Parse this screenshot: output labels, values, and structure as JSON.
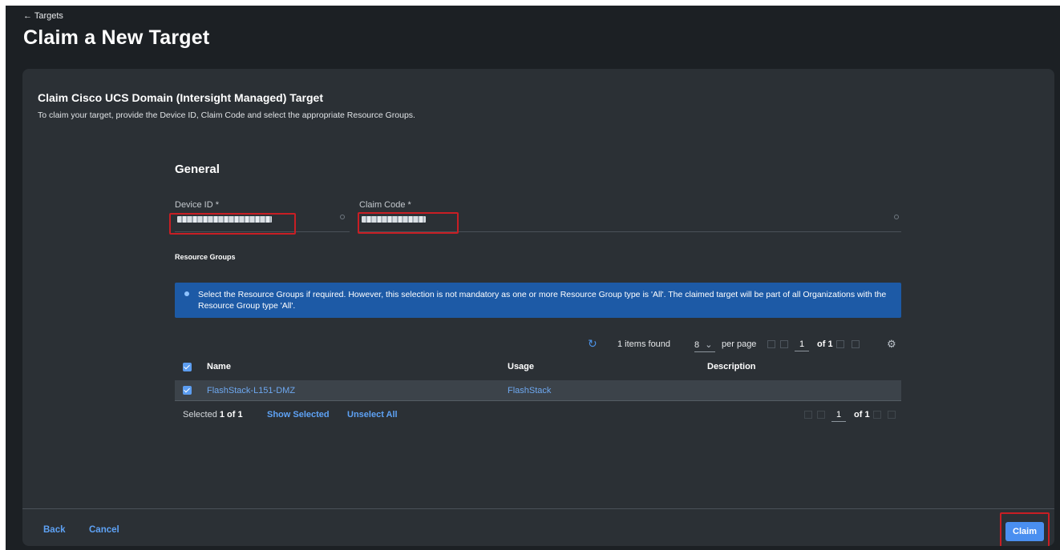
{
  "header": {
    "back_label": "← Targets",
    "title": "Claim a New Target"
  },
  "panel": {
    "title": "Claim Cisco UCS Domain (Intersight Managed) Target",
    "description": "To claim your target, provide the Device ID, Claim Code and select the appropriate Resource Groups."
  },
  "general": {
    "title": "General",
    "device_id_label": "Device ID *",
    "claim_code_label": "Claim Code *",
    "device_id_value_redacted": true,
    "claim_code_value_redacted": true
  },
  "resource_groups": {
    "label": "Resource Groups",
    "info_text": "Select the Resource Groups if required. However, this selection is not mandatory as one or more Resource Group type is 'All'. The claimed target will be part of all Organizations with the Resource Group type 'All'.",
    "items_found": "1 items found",
    "per_page_value": "8",
    "per_page_label": "per page",
    "page_number": "1",
    "page_of": "of 1",
    "columns": [
      "Name",
      "Usage",
      "Description"
    ],
    "rows": [
      {
        "name": "FlashStack-L151-DMZ",
        "usage": "FlashStack",
        "description": "",
        "checked": true
      }
    ],
    "selected_prefix": "Selected",
    "selected_count": "1 of 1",
    "show_selected": "Show Selected",
    "unselect_all": "Unselect All",
    "bottom_page_number": "1",
    "bottom_page_of": "of 1"
  },
  "footer": {
    "back": "Back",
    "cancel": "Cancel",
    "claim": "Claim"
  },
  "colors": {
    "background": "#1c2024",
    "panel": "#2b3035",
    "accent": "#4a8ff0",
    "info_banner": "#1d5aa6",
    "highlight_border": "#c81e24"
  },
  "icons": [
    "back-arrow-icon",
    "info-icon",
    "refresh-icon",
    "chevron-down-icon",
    "first-page-icon",
    "previous-page-icon",
    "next-page-icon",
    "last-page-icon",
    "settings-gear-icon",
    "checkbox-checked-icon"
  ]
}
